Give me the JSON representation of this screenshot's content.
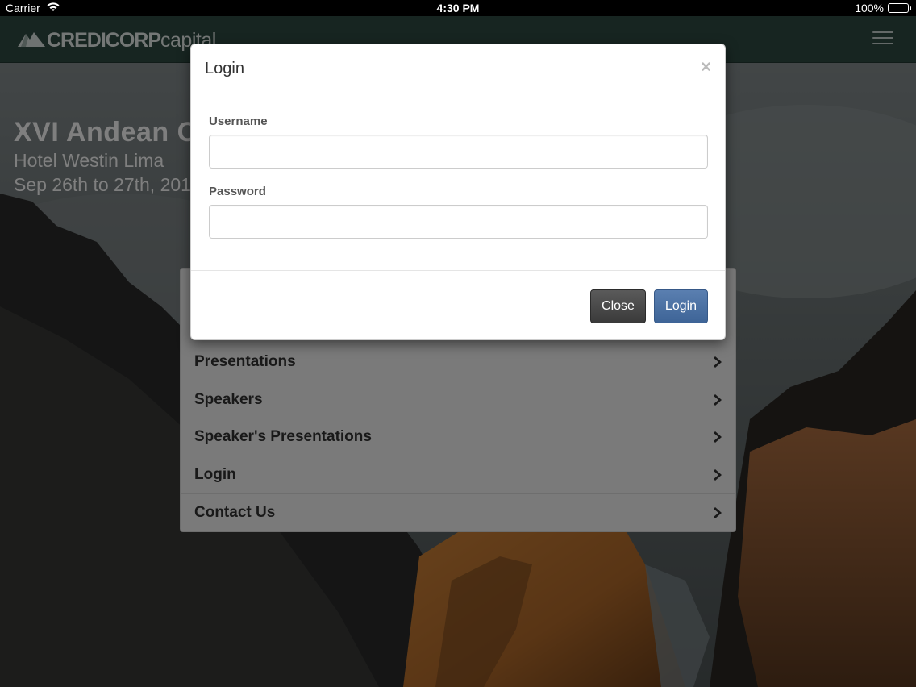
{
  "statusbar": {
    "carrier": "Carrier",
    "time": "4:30 PM",
    "battery": "100%"
  },
  "navbar": {
    "brand_bold": "CREDICORP",
    "brand_light": "capital"
  },
  "hero": {
    "title": "XVI Andean C",
    "venue": "Hotel Westin Lima",
    "dates": "Sep 26th to 27th, 201"
  },
  "menu": {
    "items": [
      {
        "label": ""
      },
      {
        "label": ""
      },
      {
        "label": "Presentations"
      },
      {
        "label": "Speakers"
      },
      {
        "label": "Speaker's Presentations"
      },
      {
        "label": "Login"
      },
      {
        "label": "Contact Us"
      }
    ]
  },
  "modal": {
    "title": "Login",
    "close_glyph": "×",
    "username_label": "Username",
    "username_value": "",
    "password_label": "Password",
    "password_value": "",
    "close_button": "Close",
    "login_button": "Login"
  },
  "colors": {
    "navbar": "#2f4a43",
    "login_button": "#4a6fa5",
    "close_button": "#454545"
  },
  "icons": {
    "menu_chevron": "chevron-right-icon",
    "hamburger": "hamburger-menu-icon",
    "wifi": "wifi-icon",
    "battery": "battery-icon"
  }
}
